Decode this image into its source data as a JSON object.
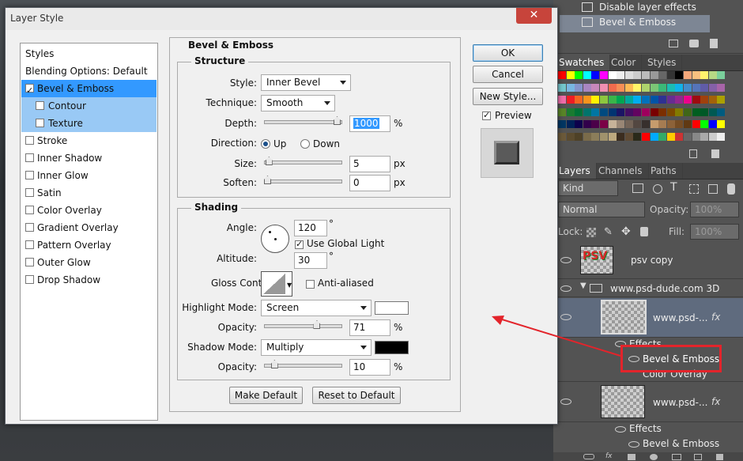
{
  "dialog": {
    "title": "Layer Style",
    "close": "✕"
  },
  "styles": [
    {
      "label": "Styles",
      "type": "hdr"
    },
    {
      "label": "Blending Options: Default",
      "type": "hdr"
    },
    {
      "label": "Bevel & Emboss",
      "type": "sel",
      "checked": true
    },
    {
      "label": "Contour",
      "type": "sub",
      "checked": false
    },
    {
      "label": "Texture",
      "type": "sub",
      "checked": false
    },
    {
      "label": "Stroke",
      "checked": false
    },
    {
      "label": "Inner Shadow",
      "checked": false
    },
    {
      "label": "Inner Glow",
      "checked": false
    },
    {
      "label": "Satin",
      "checked": false
    },
    {
      "label": "Color Overlay",
      "checked": false
    },
    {
      "label": "Gradient Overlay",
      "checked": false
    },
    {
      "label": "Pattern Overlay",
      "checked": false
    },
    {
      "label": "Outer Glow",
      "checked": false
    },
    {
      "label": "Drop Shadow",
      "checked": false
    }
  ],
  "bevel": {
    "title": "Bevel & Emboss",
    "structure": {
      "title": "Structure",
      "style_label": "Style:",
      "style_value": "Inner Bevel",
      "technique_label": "Technique:",
      "technique_value": "Smooth",
      "depth_label": "Depth:",
      "depth_value": "1000",
      "depth_unit": "%",
      "depth_level": 1.0,
      "direction_label": "Direction:",
      "direction_up": "Up",
      "direction_down": "Down",
      "size_label": "Size:",
      "size_value": "5",
      "size_unit": "px",
      "size_level": 0.02,
      "soften_label": "Soften:",
      "soften_value": "0",
      "soften_unit": "px",
      "soften_level": 0.0
    },
    "shading": {
      "title": "Shading",
      "angle_label": "Angle:",
      "angle_value": "120",
      "angle_unit": "°",
      "global_light_label": "Use Global Light",
      "global_light": true,
      "altitude_label": "Altitude:",
      "altitude_value": "30",
      "altitude_unit": "°",
      "gloss_label": "Gloss Contour:",
      "anti_aliased_label": "Anti-aliased",
      "highlight_mode_label": "Highlight Mode:",
      "highlight_mode": "Screen",
      "highlight_color": "#ffffff",
      "h_opacity_label": "Opacity:",
      "h_opacity_value": "71",
      "h_opacity_unit": "%",
      "h_opacity_level": 0.71,
      "shadow_mode_label": "Shadow Mode:",
      "shadow_mode": "Multiply",
      "shadow_color": "#000000",
      "s_opacity_label": "Opacity:",
      "s_opacity_value": "10",
      "s_opacity_unit": "%",
      "s_opacity_level": 0.1
    },
    "make_default": "Make Default",
    "reset_default": "Reset to Default"
  },
  "buttons": {
    "ok": "OK",
    "cancel": "Cancel",
    "new_style": "New Style...",
    "preview": "Preview"
  },
  "history": [
    "Disable layer effects",
    "Bevel & Emboss"
  ],
  "swatch_tabs": [
    "Swatches",
    "Color",
    "Styles"
  ],
  "layer_tabs": [
    "Layers",
    "Channels",
    "Paths"
  ],
  "layers_panel": {
    "kind": "Kind",
    "blend": "Normal",
    "opacity_label": "Opacity:",
    "opacity": "100%",
    "lock_label": "Lock:",
    "fill_label": "Fill:",
    "fill": "100%"
  },
  "layers": {
    "psv_name": "psv copy",
    "psv_badge": "PSV",
    "group_name": "www.psd-dude.com 3D",
    "layer1_name": "www.psd-...",
    "fx": "fx",
    "effects": "Effects",
    "bevel": "Bevel & Emboss",
    "color_overlay": "Color Overlay",
    "layer2_name": "www.psd-...",
    "effects2": "Effects",
    "bevel2": "Bevel & Emboss"
  },
  "colors": {
    "accent_red": "#e3242b",
    "selection": "#3399ff"
  }
}
